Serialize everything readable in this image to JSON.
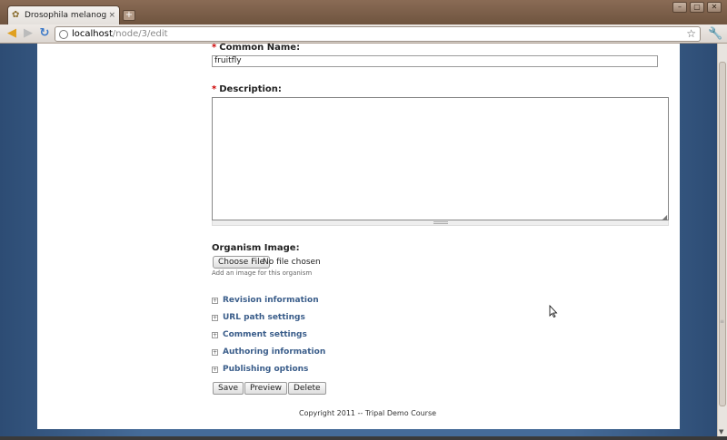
{
  "browser": {
    "tab_title": "Drosophila melanoga...",
    "tab_close": "×",
    "new_tab": "+",
    "url_host": "localhost",
    "url_path": "/node/3/edit"
  },
  "form": {
    "common_name_label": "Common Name:",
    "common_name_value": "fruitfly",
    "description_label": "Description:",
    "description_value": "",
    "required_marker": "*",
    "image_label": "Organism Image:",
    "choose_file_label": "Choose File",
    "no_file_text": "No file chosen",
    "image_help": "Add an image for this organism"
  },
  "fieldsets": [
    {
      "label": "Revision information"
    },
    {
      "label": "URL path settings"
    },
    {
      "label": "Comment settings"
    },
    {
      "label": "Authoring information"
    },
    {
      "label": "Publishing options"
    }
  ],
  "buttons": {
    "save": "Save",
    "preview": "Preview",
    "delete": "Delete"
  },
  "footer": {
    "copyright": "Copyright 2011 -- Tripal Demo Course"
  }
}
